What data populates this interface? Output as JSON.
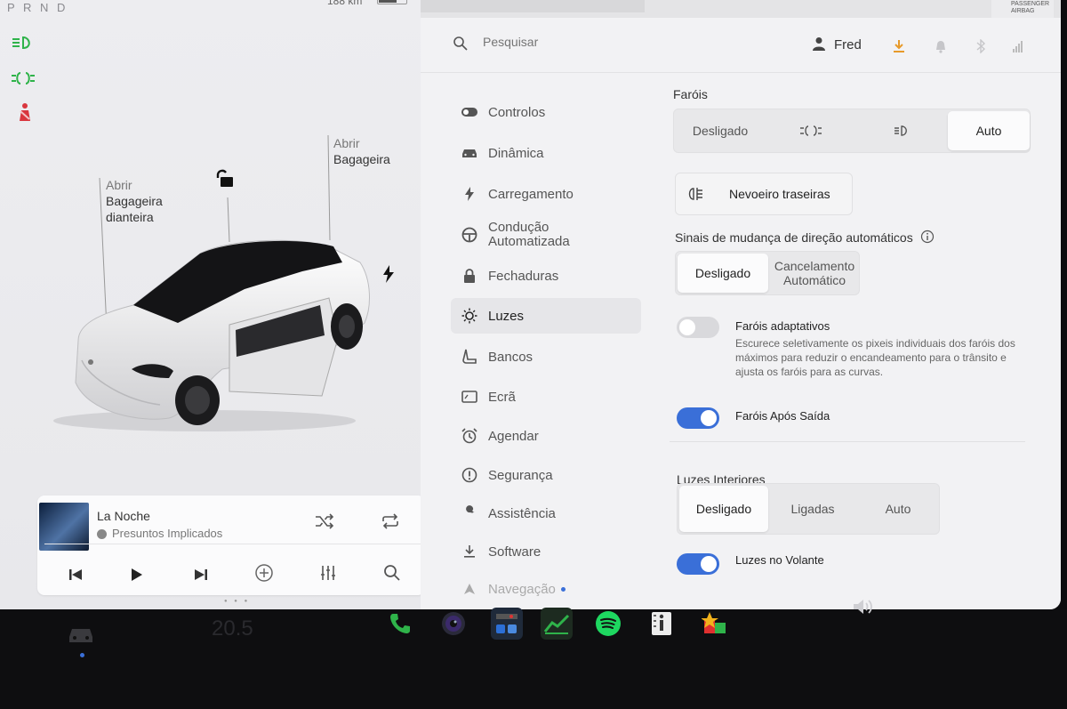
{
  "status": {
    "gear": "P R N D",
    "range": "188 km"
  },
  "car": {
    "front_trunk_action": "Abrir",
    "front_trunk_name_1": "Bagageira",
    "front_trunk_name_2": "dianteira",
    "trunk_action": "Abrir",
    "trunk_name": "Bagageira"
  },
  "music": {
    "title": "La Noche",
    "artist": "Presuntos Implicados"
  },
  "header": {
    "search_placeholder": "Pesquisar",
    "user": "Fred",
    "airbag_line1": "PASSENGER",
    "airbag_line2": "AIRBAG"
  },
  "nav": {
    "items": [
      {
        "label": "Controlos",
        "icon": "toggle-icon"
      },
      {
        "label": "Dinâmica",
        "icon": "car-icon"
      },
      {
        "label": "Carregamento",
        "icon": "bolt-icon"
      },
      {
        "label": "Condução\nAutomatizada",
        "icon": "steering-wheel-icon"
      },
      {
        "label": "Fechaduras",
        "icon": "lock-icon"
      },
      {
        "label": "Luzes",
        "icon": "light-icon"
      },
      {
        "label": "Bancos",
        "icon": "seat-icon"
      },
      {
        "label": "Ecrã",
        "icon": "display-icon"
      },
      {
        "label": "Agendar",
        "icon": "alarm-icon"
      },
      {
        "label": "Segurança",
        "icon": "info-icon"
      },
      {
        "label": "Assistência",
        "icon": "wrench-icon"
      },
      {
        "label": "Software",
        "icon": "download-icon"
      },
      {
        "label": "Navegação",
        "icon": "navigation-icon"
      }
    ],
    "active": "Luzes"
  },
  "settings": {
    "headlights": {
      "title": "Faróis",
      "off": "Desligado",
      "auto": "Auto",
      "selected": "Auto"
    },
    "rear_fog": {
      "label": "Nevoeiro traseiras"
    },
    "turn_signals": {
      "title": "Sinais de mudança de direção automáticos",
      "off": "Desligado",
      "cancel_line1": "Cancelamento",
      "cancel_line2": "Automático",
      "selected": "Desligado"
    },
    "adaptive": {
      "label": "Faróis adaptativos",
      "description": "Escurece seletivamente os pixeis individuais dos faróis dos máximos para reduzir o encandeamento para o trânsito e ajusta os faróis para as curvas.",
      "on": false
    },
    "after_exit": {
      "label": "Faróis Após Saída",
      "on": true
    },
    "interior": {
      "title": "Luzes Interiores",
      "off": "Desligado",
      "on_label": "Ligadas",
      "auto": "Auto",
      "selected": "Desligado"
    },
    "steering_lights": {
      "label": "Luzes no Volante",
      "on": true
    }
  },
  "dock": {
    "temperature": "20.5"
  },
  "colors": {
    "accent": "#3a6fd8",
    "telltale_green": "#2fb34a",
    "telltale_red": "#d9363e"
  }
}
